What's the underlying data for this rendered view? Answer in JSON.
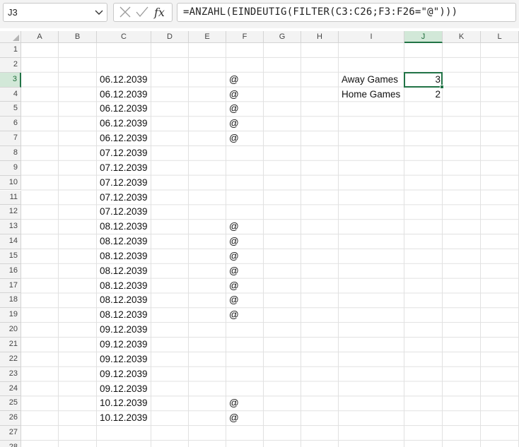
{
  "formula_bar": {
    "name_box": "J3",
    "formula": "=ANZAHL(EINDEUTIG(FILTER(C3:C26;F3:F26=\"@\")))",
    "icons": {
      "dropdown": "chevron-down-icon",
      "cancel": "close-icon",
      "enter": "check-icon",
      "insert_function": "fx-icon"
    }
  },
  "grid": {
    "columns": [
      "A",
      "B",
      "C",
      "D",
      "E",
      "F",
      "G",
      "H",
      "I",
      "J",
      "K",
      "L"
    ],
    "selected_column": "J",
    "selected_row": 3,
    "rows": [
      {
        "n": "1",
        "C": "",
        "F": "",
        "I": "",
        "J": ""
      },
      {
        "n": "2",
        "C": "",
        "F": "",
        "I": "",
        "J": ""
      },
      {
        "n": "3",
        "C": "06.12.2039",
        "F": "@",
        "I": "Away Games",
        "J": "3"
      },
      {
        "n": "4",
        "C": "06.12.2039",
        "F": "@",
        "I": "Home Games",
        "J": "2"
      },
      {
        "n": "5",
        "C": "06.12.2039",
        "F": "@",
        "I": "",
        "J": ""
      },
      {
        "n": "6",
        "C": "06.12.2039",
        "F": "@",
        "I": "",
        "J": ""
      },
      {
        "n": "7",
        "C": "06.12.2039",
        "F": "@",
        "I": "",
        "J": ""
      },
      {
        "n": "8",
        "C": "07.12.2039",
        "F": "",
        "I": "",
        "J": ""
      },
      {
        "n": "9",
        "C": "07.12.2039",
        "F": "",
        "I": "",
        "J": ""
      },
      {
        "n": "10",
        "C": "07.12.2039",
        "F": "",
        "I": "",
        "J": ""
      },
      {
        "n": "11",
        "C": "07.12.2039",
        "F": "",
        "I": "",
        "J": ""
      },
      {
        "n": "12",
        "C": "07.12.2039",
        "F": "",
        "I": "",
        "J": ""
      },
      {
        "n": "13",
        "C": "08.12.2039",
        "F": "@",
        "I": "",
        "J": ""
      },
      {
        "n": "14",
        "C": "08.12.2039",
        "F": "@",
        "I": "",
        "J": ""
      },
      {
        "n": "15",
        "C": "08.12.2039",
        "F": "@",
        "I": "",
        "J": ""
      },
      {
        "n": "16",
        "C": "08.12.2039",
        "F": "@",
        "I": "",
        "J": ""
      },
      {
        "n": "17",
        "C": "08.12.2039",
        "F": "@",
        "I": "",
        "J": ""
      },
      {
        "n": "18",
        "C": "08.12.2039",
        "F": "@",
        "I": "",
        "J": ""
      },
      {
        "n": "19",
        "C": "08.12.2039",
        "F": "@",
        "I": "",
        "J": ""
      },
      {
        "n": "20",
        "C": "09.12.2039",
        "F": "",
        "I": "",
        "J": ""
      },
      {
        "n": "21",
        "C": "09.12.2039",
        "F": "",
        "I": "",
        "J": ""
      },
      {
        "n": "22",
        "C": "09.12.2039",
        "F": "",
        "I": "",
        "J": ""
      },
      {
        "n": "23",
        "C": "09.12.2039",
        "F": "",
        "I": "",
        "J": ""
      },
      {
        "n": "24",
        "C": "09.12.2039",
        "F": "",
        "I": "",
        "J": ""
      },
      {
        "n": "25",
        "C": "10.12.2039",
        "F": "@",
        "I": "",
        "J": ""
      },
      {
        "n": "26",
        "C": "10.12.2039",
        "F": "@",
        "I": "",
        "J": ""
      },
      {
        "n": "27",
        "C": "",
        "F": "",
        "I": "",
        "J": ""
      },
      {
        "n": "28",
        "C": "",
        "F": "",
        "I": "",
        "J": ""
      }
    ]
  }
}
